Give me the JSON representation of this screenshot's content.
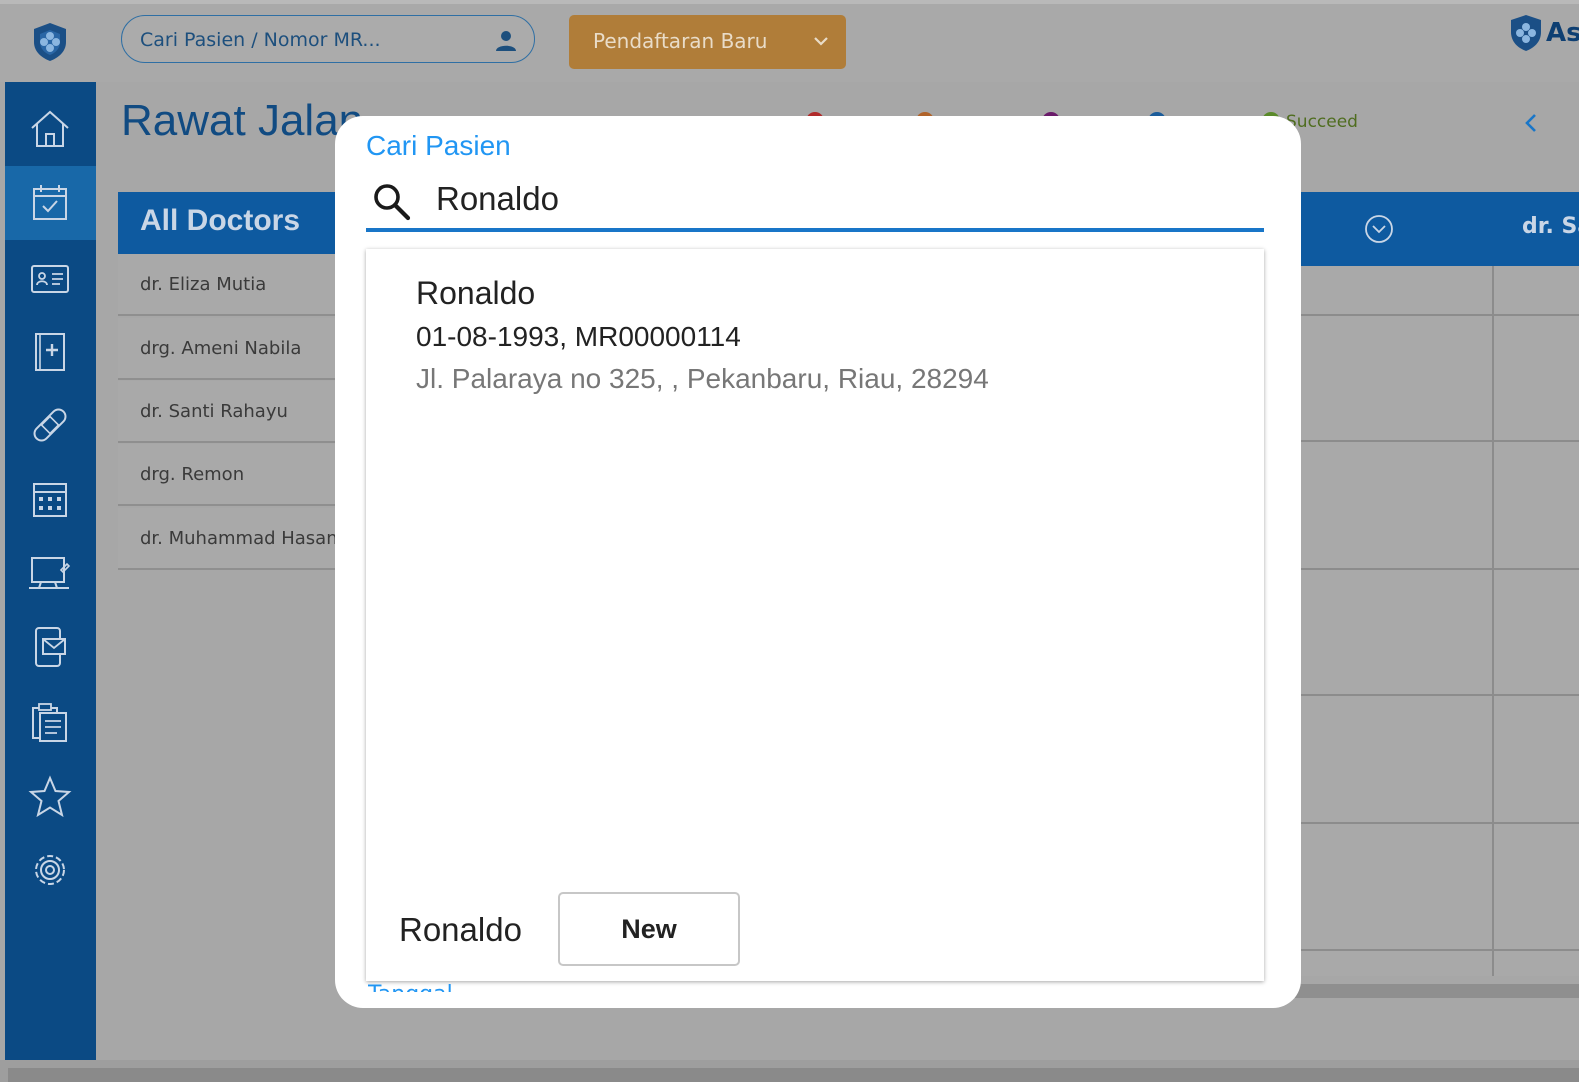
{
  "header": {
    "search_placeholder": "Cari Pasien / Nomor MR...",
    "new_registration_label": "Pendaftaran Baru",
    "brand_text": "As"
  },
  "page": {
    "title": "Rawat Jalan",
    "legend": {
      "succeed_label": "Succeed",
      "colors": [
        "#b02a2a",
        "#b0632a",
        "#6a1b6a",
        "#1b5c9a",
        "#5a8a2a"
      ]
    }
  },
  "doctors": {
    "header": "All Doctors",
    "items": [
      "dr. Eliza Mutia",
      "drg. Ameni Nabila",
      "dr. Santi Rahayu",
      "drg. Remon",
      "dr. Muhammad Hasan"
    ]
  },
  "schedule": {
    "column_doctor": "dr. Sa"
  },
  "sidebar": {
    "icons": [
      "home-icon",
      "calendar-check-icon",
      "id-card-icon",
      "medical-book-icon",
      "bandage-icon",
      "calculator-icon",
      "computer-icon",
      "mobile-mail-icon",
      "clipboard-icon",
      "star-icon",
      "settings-icon"
    ]
  },
  "modal": {
    "title": "Cari Pasien",
    "search_value": "Ronaldo",
    "results": [
      {
        "name": "Ronaldo",
        "meta": "01-08-1993, MR00000114",
        "address": "Jl. Palaraya no 325, , Pekanbaru, Riau, 28294"
      }
    ],
    "new_patient_name": "Ronaldo",
    "new_button_label": "New",
    "peek_text": "Tanggal"
  },
  "colors": {
    "accent": "#2196f3",
    "sidebar": "#0b4a84",
    "primary_button": "#b07d39"
  }
}
